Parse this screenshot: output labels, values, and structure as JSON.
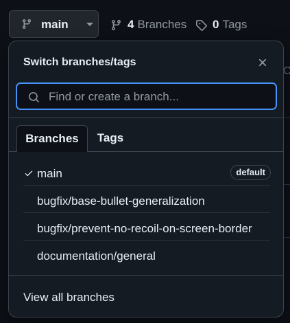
{
  "topbar": {
    "current_branch": "main",
    "branches_count": "4",
    "branches_label": "Branches",
    "tags_count": "0",
    "tags_label": "Tags"
  },
  "background": {
    "edge_text": "Ca"
  },
  "dropdown": {
    "title": "Switch branches/tags",
    "search_placeholder": "Find or create a branch...",
    "tabs": [
      {
        "label": "Branches",
        "active": true
      },
      {
        "label": "Tags",
        "active": false
      }
    ],
    "branches": [
      {
        "name": "main",
        "selected": true,
        "badge": "default"
      },
      {
        "name": "bugfix/base-bullet-generalization",
        "selected": false
      },
      {
        "name": "bugfix/prevent-no-recoil-on-screen-border",
        "selected": false
      },
      {
        "name": "documentation/general",
        "selected": false
      }
    ],
    "footer_link": "View all branches"
  },
  "colors": {
    "background": "#0d1117",
    "panel": "#151b23",
    "border": "#3d444d",
    "accent_focus": "#4493f8",
    "text_primary": "#e6edf3",
    "text_muted": "#9198a1"
  },
  "icons": {
    "branch": "git-branch-icon",
    "tag": "tag-icon",
    "search": "search-icon",
    "close": "close-icon",
    "check": "check-icon",
    "caret": "caret-down-icon"
  }
}
